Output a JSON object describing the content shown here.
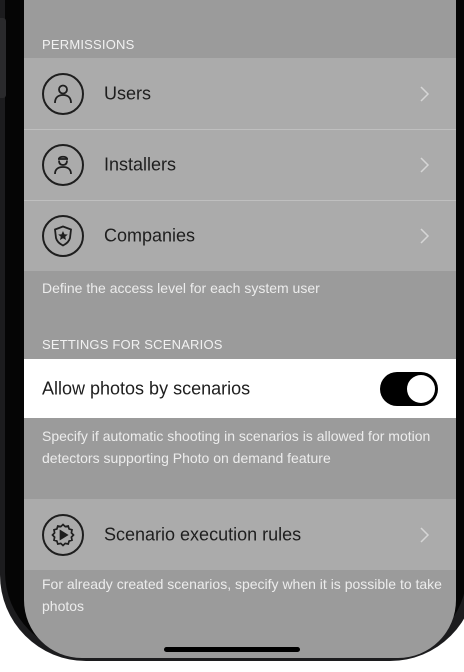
{
  "permissions": {
    "header": "PERMISSIONS",
    "items": [
      {
        "label": "Users",
        "icon": "user-icon"
      },
      {
        "label": "Installers",
        "icon": "installer-icon"
      },
      {
        "label": "Companies",
        "icon": "shield-star-icon"
      }
    ],
    "description": "Define the access level for each system user"
  },
  "scenarios": {
    "header": "SETTINGS FOR SCENARIOS",
    "toggle_label": "Allow photos by scenarios",
    "toggle_on": true,
    "toggle_description": "Specify if automatic shooting in scenarios is allowed for motion detectors supporting Photo on demand feature",
    "rules_label": "Scenario execution rules",
    "rules_icon": "gear-play-icon",
    "rules_description": "For already created scenarios, specify when it is possible to take photos"
  },
  "colors": {
    "background_dim": "#9b9b9b",
    "row_bg": "#ababab",
    "highlight_bg": "#ffffff",
    "toggle_on": "#000000"
  }
}
